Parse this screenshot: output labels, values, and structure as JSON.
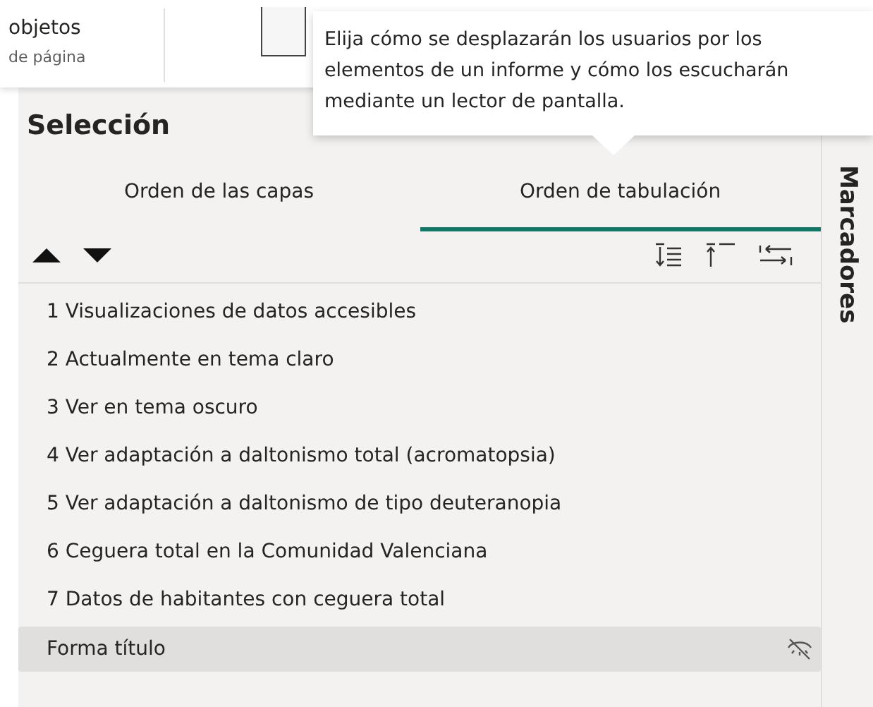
{
  "ribbon": {
    "labels": [
      "objetos",
      "de página"
    ]
  },
  "panel": {
    "title": "Selección",
    "tabs": [
      {
        "label": "Orden de las capas",
        "selected": false
      },
      {
        "label": "Orden de tabulación",
        "selected": true
      }
    ],
    "items": [
      {
        "label": "1 Visualizaciones de datos accesibles",
        "selected": false,
        "hidden": false
      },
      {
        "label": "2 Actualmente en tema claro",
        "selected": false,
        "hidden": false
      },
      {
        "label": "3 Ver en tema oscuro",
        "selected": false,
        "hidden": false
      },
      {
        "label": "4 Ver adaptación a daltonismo total (acromatopsia)",
        "selected": false,
        "hidden": false
      },
      {
        "label": "5 Ver adaptación a daltonismo de tipo deuteranopia",
        "selected": false,
        "hidden": false
      },
      {
        "label": "6 Ceguera total en la Comunidad Valenciana",
        "selected": false,
        "hidden": false
      },
      {
        "label": "7 Datos de habitantes con ceguera total",
        "selected": false,
        "hidden": false
      },
      {
        "label": "Forma título",
        "selected": true,
        "hidden": true
      }
    ]
  },
  "side_panel": {
    "title": "Marcadores"
  },
  "tooltip": {
    "text": "Elija cómo se desplazarán los usuarios por los elementos de un informe y cómo los escucharán mediante un lector de pantalla."
  }
}
